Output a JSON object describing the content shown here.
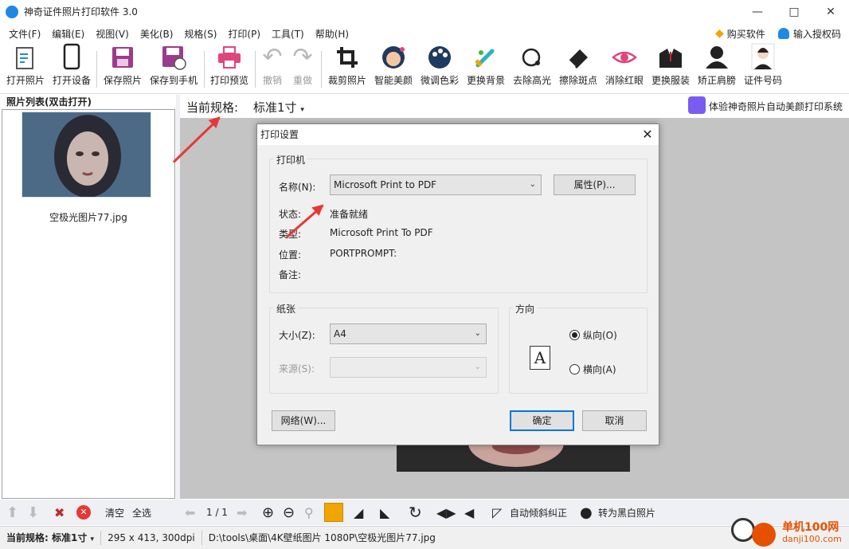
{
  "window": {
    "title": "神奇证件照片打印软件 3.0"
  },
  "menu": [
    "文件(F)",
    "编辑(E)",
    "视图(V)",
    "美化(B)",
    "规格(S)",
    "打印(P)",
    "工具(T)",
    "帮助(H)"
  ],
  "menu_right": {
    "buy": "购买软件",
    "license": "输入授权码"
  },
  "toolbar": {
    "open_photo": "打开照片",
    "open_device": "打开设备",
    "save_photo": "保存照片",
    "save_to_phone": "保存到手机",
    "print_preview": "打印预览",
    "undo": "撤销",
    "redo": "重做",
    "crop": "裁剪照片",
    "smart_beauty": "智能美颜",
    "adjust_color": "微调色彩",
    "change_bg": "更换背景",
    "remove_highlight": "去除高光",
    "erase_spots": "擦除斑点",
    "remove_redeye": "消除红眼",
    "change_clothes": "更换服装",
    "fix_shoulder": "矫正肩膀",
    "id_number": "证件号码"
  },
  "left_panel": {
    "header": "照片列表(双击打开)",
    "file_name": "空极光图片77.jpg"
  },
  "spec_bar": {
    "label": "当前规格:",
    "value": "标准1寸",
    "promo": "体验神奇照片自动美颜打印系统"
  },
  "dialog": {
    "title": "打印设置",
    "printer_group": "打印机",
    "name_label": "名称(N):",
    "printer_name": "Microsoft Print to PDF",
    "properties_button": "属性(P)...",
    "status_label": "状态:",
    "status_value": "准备就绪",
    "type_label": "类型:",
    "type_value": "Microsoft Print To PDF",
    "location_label": "位置:",
    "location_value": "PORTPROMPT:",
    "comment_label": "备注:",
    "paper_group": "纸张",
    "size_label": "大小(Z):",
    "size_value": "A4",
    "source_label": "来源(S):",
    "source_value": "",
    "orientation_group": "方向",
    "portrait": "纵向(O)",
    "landscape": "横向(A)",
    "orientation_selected": "portrait",
    "network_button": "网络(W)...",
    "ok_button": "确定",
    "cancel_button": "取消"
  },
  "bottom_bar": {
    "clear": "清空",
    "select_all": "全选",
    "page": "1 / 1",
    "auto_deskew": "自动倾斜纠正",
    "to_bw": "转为黑白照片"
  },
  "status_bar": {
    "spec_label": "当前规格:",
    "spec_value": "标准1寸",
    "dims": "295 x 413, 300dpi",
    "path": "D:\\tools\\桌面\\4K壁纸图片 1080P\\空极光图片77.jpg"
  },
  "watermark": {
    "site": "单机100网",
    "url": "danji100.com"
  },
  "colors": {
    "accent": "#0078d7",
    "arrow": "#e53935",
    "preview_bg": "#c4c4c4"
  }
}
